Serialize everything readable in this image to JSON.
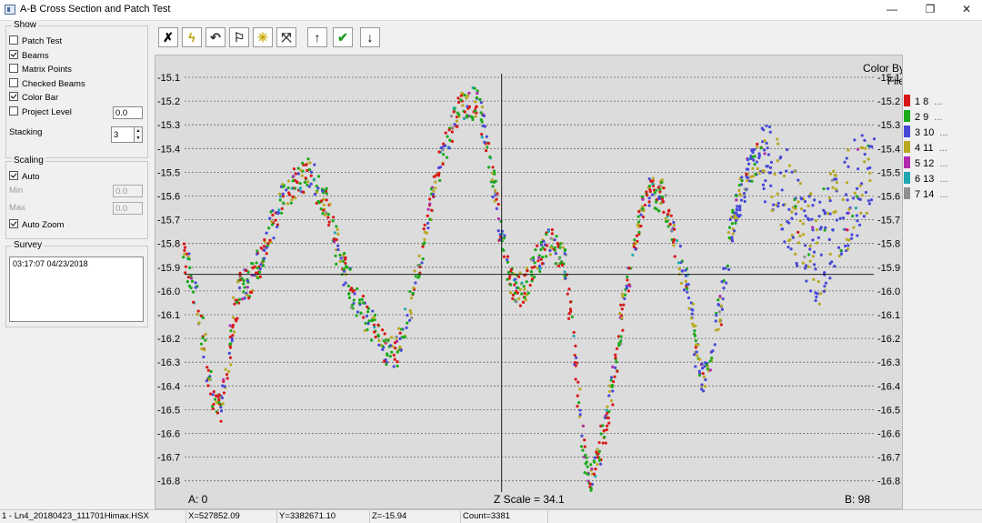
{
  "window": {
    "title": "A-B Cross Section and Patch Test",
    "minimize": "—",
    "restore": "❐",
    "close": "✕"
  },
  "show_group": {
    "label": "Show",
    "checkboxes": [
      {
        "label": "Patch Test",
        "checked": false
      },
      {
        "label": "Beams",
        "checked": true
      },
      {
        "label": "Matrix Points",
        "checked": false
      },
      {
        "label": "Checked Beams",
        "checked": false
      },
      {
        "label": "Color Bar",
        "checked": true
      },
      {
        "label": "Project Level",
        "checked": false
      }
    ],
    "project_level_value": "0.0",
    "stacking_label": "Stacking",
    "stacking_value": "3"
  },
  "scaling_group": {
    "label": "Scaling",
    "auto_label": "Auto",
    "auto_checked": true,
    "min_label": "Min",
    "min_value": "0.0",
    "max_label": "Max",
    "max_value": "0.0",
    "auto_zoom_label": "Auto Zoom",
    "auto_zoom_checked": true
  },
  "survey_group": {
    "label": "Survey",
    "entry": "03:17:07 04/23/2018"
  },
  "toolbar": [
    {
      "name": "close-x-button",
      "icon": "x-icon",
      "glyph": "✗"
    },
    {
      "name": "lightning-button",
      "icon": "lightning-icon",
      "glyph": "ϟ"
    },
    {
      "name": "undo-button",
      "icon": "undo-icon",
      "glyph": "↶"
    },
    {
      "name": "flag-button",
      "icon": "flag-icon",
      "glyph": "⚐"
    },
    {
      "name": "sun-button",
      "icon": "sun-icon",
      "glyph": "✳"
    },
    {
      "name": "fit-button",
      "icon": "expand-icon",
      "glyph": "⤧"
    },
    {
      "name": "up-button",
      "icon": "arrow-up-icon",
      "glyph": "↑"
    },
    {
      "name": "accept-button",
      "icon": "check-icon",
      "glyph": "✔"
    },
    {
      "name": "down-button",
      "icon": "arrow-down-icon",
      "glyph": "↓"
    }
  ],
  "plot": {
    "a_label": "A: 0",
    "b_label": "B: 98",
    "z_scale_label": "Z Scale = 34.1",
    "color_by_label": "Color By File",
    "legend": [
      {
        "pair": "1  8",
        "color": "#d81818"
      },
      {
        "pair": "2  9",
        "color": "#1aaa1a"
      },
      {
        "pair": "3  10",
        "color": "#4848d8"
      },
      {
        "pair": "4  11",
        "color": "#b8a820"
      },
      {
        "pair": "5  12",
        "color": "#b02ab0"
      },
      {
        "pair": "6  13",
        "color": "#20a8b0"
      },
      {
        "pair": "7  14",
        "color": "#909090"
      }
    ],
    "legend_ellipsis": "...",
    "crosshair": {
      "position": 0.46,
      "depth": -15.93
    }
  },
  "chart_data": {
    "type": "scatter",
    "title": "",
    "xlabel": "",
    "ylabel": "",
    "xlim": [
      0,
      98
    ],
    "ylim": [
      -16.85,
      -15.05
    ],
    "y_inverted": true,
    "yticks": [
      "-15.1",
      "-15.2",
      "-15.3",
      "-15.4",
      "-15.5",
      "-15.6",
      "-15.7",
      "-15.8",
      "-15.9",
      "-16.0",
      "-16.1",
      "-16.2",
      "-16.3",
      "-16.4",
      "-16.5",
      "-16.6",
      "-16.7",
      "-16.8"
    ],
    "grid": "horizontal-dashed",
    "profile": [
      [
        0,
        -15.86
      ],
      [
        1,
        -15.95
      ],
      [
        2,
        -16.1
      ],
      [
        3,
        -16.28
      ],
      [
        4,
        -16.45
      ],
      [
        5,
        -16.5
      ],
      [
        6,
        -16.35
      ],
      [
        7,
        -16.1
      ],
      [
        8,
        -15.98
      ],
      [
        9,
        -15.97
      ],
      [
        10,
        -15.92
      ],
      [
        11,
        -15.85
      ],
      [
        12,
        -15.75
      ],
      [
        14,
        -15.62
      ],
      [
        16,
        -15.53
      ],
      [
        18,
        -15.51
      ],
      [
        20,
        -15.62
      ],
      [
        22,
        -15.85
      ],
      [
        24,
        -16.02
      ],
      [
        26,
        -16.12
      ],
      [
        28,
        -16.22
      ],
      [
        30,
        -16.27
      ],
      [
        32,
        -16.08
      ],
      [
        34,
        -15.8
      ],
      [
        36,
        -15.5
      ],
      [
        38,
        -15.3
      ],
      [
        40,
        -15.2
      ],
      [
        42,
        -15.22
      ],
      [
        44,
        -15.55
      ],
      [
        46,
        -15.95
      ],
      [
        48,
        -16.0
      ],
      [
        50,
        -15.88
      ],
      [
        52,
        -15.8
      ],
      [
        54,
        -15.88
      ],
      [
        55,
        -16.1
      ],
      [
        56,
        -16.45
      ],
      [
        57,
        -16.72
      ],
      [
        58,
        -16.78
      ],
      [
        60,
        -16.55
      ],
      [
        62,
        -16.15
      ],
      [
        64,
        -15.78
      ],
      [
        66,
        -15.58
      ],
      [
        68,
        -15.6
      ],
      [
        70,
        -15.82
      ],
      [
        72,
        -16.05
      ],
      [
        73,
        -16.3
      ],
      [
        74,
        -16.38
      ],
      [
        76,
        -16.1
      ],
      [
        78,
        -15.72
      ],
      [
        80,
        -15.5
      ],
      [
        82,
        -15.42
      ],
      [
        84,
        -15.55
      ],
      [
        86,
        -15.62
      ],
      [
        88,
        -15.75
      ],
      [
        90,
        -15.85
      ],
      [
        92,
        -15.7
      ],
      [
        94,
        -15.62
      ],
      [
        96,
        -15.55
      ],
      [
        98,
        -15.48
      ]
    ]
  },
  "statusbar": {
    "file": "1 - Ln4_20180423_111701Himax.HSX",
    "x": "X=527852.09",
    "y": "Y=3382671.10",
    "z": "Z=-15.94",
    "count": "Count=3381"
  }
}
